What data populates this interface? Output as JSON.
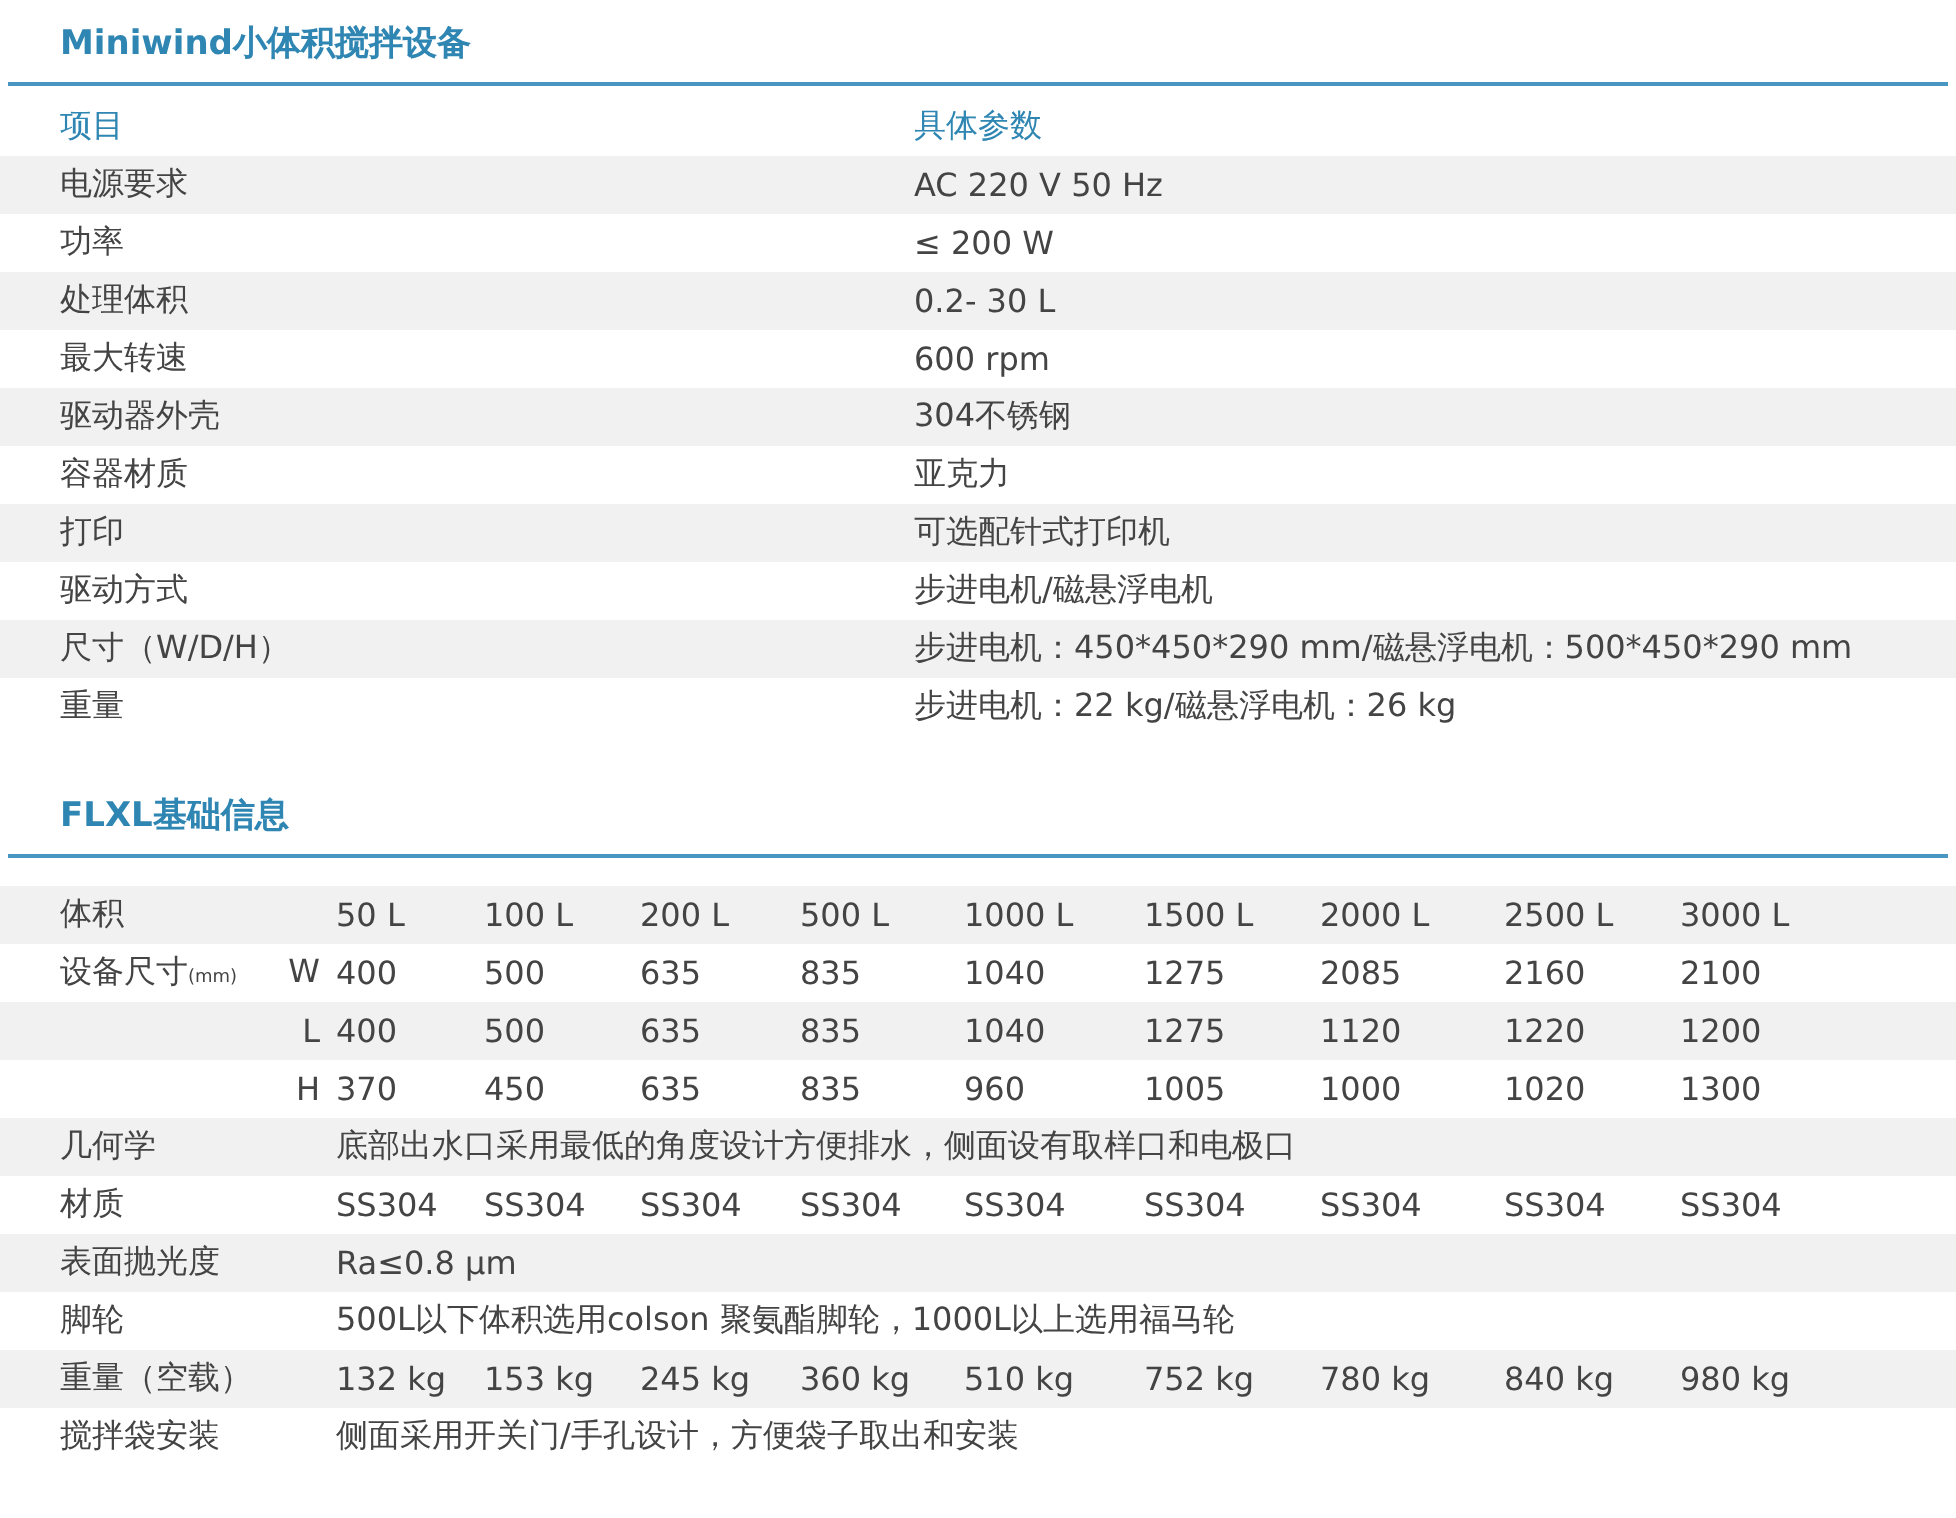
{
  "sections": [
    {
      "title": "Miniwind小体积搅拌设备",
      "kind": "pairs",
      "header": {
        "label": "项目",
        "value": "具体参数"
      },
      "rows": [
        {
          "label": "电源要求",
          "value": "AC 220  V 50 Hz"
        },
        {
          "label": "功率",
          "value": "≤ 200 W"
        },
        {
          "label": "处理体积",
          "value": "0.2- 30 L"
        },
        {
          "label": "最大转速",
          "value": "600  rpm"
        },
        {
          "label": "驱动器外壳",
          "value": "304不锈钢"
        },
        {
          "label": "容器材质",
          "value": "亚克力"
        },
        {
          "label": "打印",
          "value": "可选配针式打印机"
        },
        {
          "label": "驱动方式",
          "value": "步进电机/磁悬浮电机"
        },
        {
          "label": "尺寸（W/D/H）",
          "value": "步进电机：450*450*290 mm/磁悬浮电机：500*450*290 mm"
        },
        {
          "label": "重量",
          "value": "步进电机：22 kg/磁悬浮电机：26 kg"
        }
      ]
    },
    {
      "title": "FLXL基础信息",
      "kind": "grid",
      "rows": [
        {
          "label": "体积",
          "values": [
            "50 L",
            "100 L",
            "200 L",
            "500 L",
            "1000 L",
            "1500 L",
            "2000 L",
            "2500 L",
            "3000 L"
          ]
        },
        {
          "label": "设备尺寸",
          "unit": "(mm)",
          "sub": "W",
          "values": [
            "400",
            "500",
            "635",
            "835",
            "1040",
            "1275",
            "2085",
            "2160",
            "2100"
          ]
        },
        {
          "sub": "L",
          "values": [
            "400",
            "500",
            "635",
            "835",
            "1040",
            "1275",
            "1120",
            "1220",
            "1200"
          ]
        },
        {
          "sub": "H",
          "values": [
            "370",
            "450",
            "635",
            "835",
            "960",
            "1005",
            "1000",
            "1020",
            "1300"
          ]
        },
        {
          "label": "几何学",
          "text": "底部出水口采用最低的角度设计方便排水，侧面设有取样口和电极口"
        },
        {
          "label": "材质",
          "values": [
            "SS304",
            "SS304",
            "SS304",
            "SS304",
            "SS304",
            "SS304",
            "SS304",
            "SS304",
            "SS304"
          ]
        },
        {
          "label": "表面抛光度",
          "text": "Ra≤0.8 μm"
        },
        {
          "label": "脚轮",
          "text": "500L以下体积选用colson 聚氨酯脚轮，1000L以上选用福马轮"
        },
        {
          "label": "重量（空载）",
          "values": [
            "132 kg",
            "153 kg",
            "245 kg",
            "360 kg",
            "510 kg",
            "752 kg",
            "780 kg",
            "840 kg",
            "980 kg"
          ]
        },
        {
          "label": "搅拌袋安装",
          "text": "侧面采用开关门/手孔设计，方便袋子取出和安装"
        }
      ]
    }
  ]
}
